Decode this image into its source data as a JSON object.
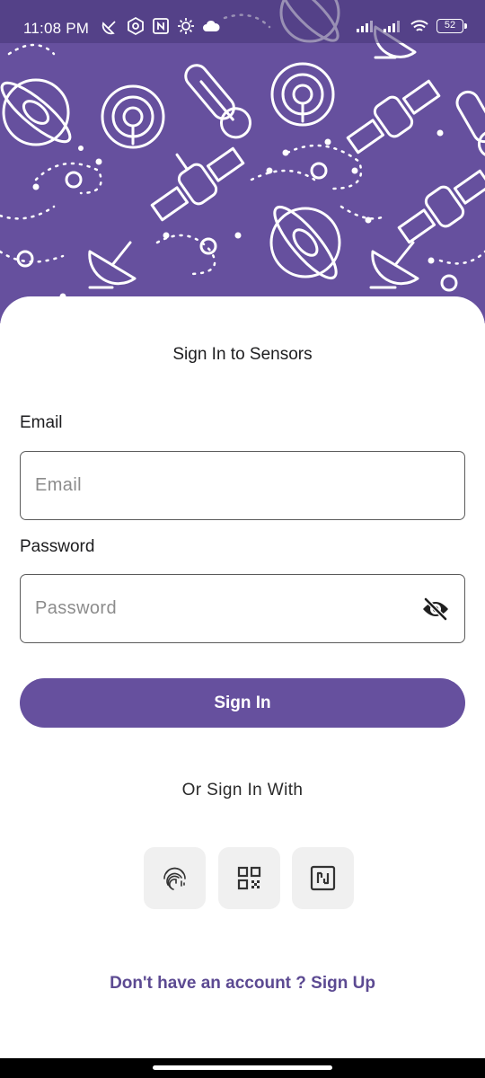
{
  "status_bar": {
    "time": "11:08 PM",
    "battery": "52",
    "left_icons": [
      "satellite-dish-icon",
      "settings-icon",
      "nfc-icon",
      "gear-icon",
      "cloud-icon"
    ],
    "right_icons": [
      "signal-icon",
      "signal-icon",
      "wifi-icon",
      "battery-icon"
    ]
  },
  "header": {
    "background_color": "#66509e",
    "pattern_icons": [
      "satellite-icon",
      "satellite-dish-icon",
      "thermometer-icon",
      "wifi-tower-icon",
      "planet-icon"
    ]
  },
  "form": {
    "title": "Sign In to Sensors",
    "email_label": "Email",
    "email_placeholder": "Email",
    "email_value": "",
    "password_label": "Password",
    "password_placeholder": "Password",
    "password_value": "",
    "password_toggle_icon": "eye-off-icon",
    "signin_label": "Sign In",
    "alt_label": "Or Sign In With",
    "alt_methods": [
      {
        "name": "fingerprint",
        "icon": "fingerprint-icon"
      },
      {
        "name": "qr-code",
        "icon": "qr-code-icon"
      },
      {
        "name": "nfc",
        "icon": "nfc-icon"
      }
    ],
    "signup_text": "Don't have an account ? Sign Up"
  },
  "colors": {
    "accent": "#66509e",
    "link": "#5c4a92",
    "alt_button_bg": "#f0f0f0"
  }
}
